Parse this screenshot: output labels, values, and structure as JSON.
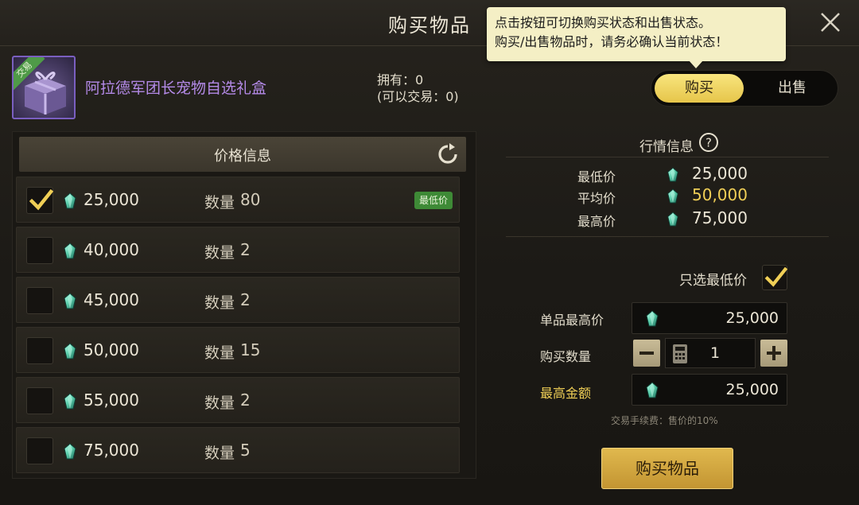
{
  "header": {
    "title": "购买物品"
  },
  "tooltip": {
    "line1": "点击按钮可切换购买状态和出售状态。",
    "line2": "购买/出售物品时，请务必确认当前状态！"
  },
  "item": {
    "tag": "交易",
    "name": "阿拉德军团长宠物自选礼盒",
    "own_line": "拥有：0",
    "tradable_line": "(可以交易：0)"
  },
  "toggle": {
    "buy": "购买",
    "sell": "出售",
    "active": "buy"
  },
  "price_panel": {
    "header": "价格信息",
    "qty_label": "数量",
    "lowest_badge": "最低价",
    "rows": [
      {
        "price": "25,000",
        "qty": "80",
        "checked": true,
        "lowest": true
      },
      {
        "price": "40,000",
        "qty": "2",
        "checked": false,
        "lowest": false
      },
      {
        "price": "45,000",
        "qty": "2",
        "checked": false,
        "lowest": false
      },
      {
        "price": "50,000",
        "qty": "15",
        "checked": false,
        "lowest": false
      },
      {
        "price": "55,000",
        "qty": "2",
        "checked": false,
        "lowest": false
      },
      {
        "price": "75,000",
        "qty": "5",
        "checked": false,
        "lowest": false
      }
    ]
  },
  "market": {
    "title": "行情信息",
    "min_label": "最低价",
    "min_value": "25,000",
    "avg_label": "平均价",
    "avg_value": "50,000",
    "max_label": "最高价",
    "max_value": "75,000"
  },
  "form": {
    "only_lowest_label": "只选最低价",
    "only_lowest_checked": true,
    "max_unit_label": "单品最高价",
    "max_unit_value": "25,000",
    "qty_label": "购买数量",
    "qty_value": "1",
    "total_label": "最高金额",
    "total_value": "25,000",
    "fee_note": "交易手续费：售价的10%",
    "buy_button": "购买物品"
  },
  "colors": {
    "gold": "#f0cf56",
    "purple_name": "#b48ae8",
    "green_badge": "#3e8a36",
    "gem": "#5fd3b0"
  }
}
